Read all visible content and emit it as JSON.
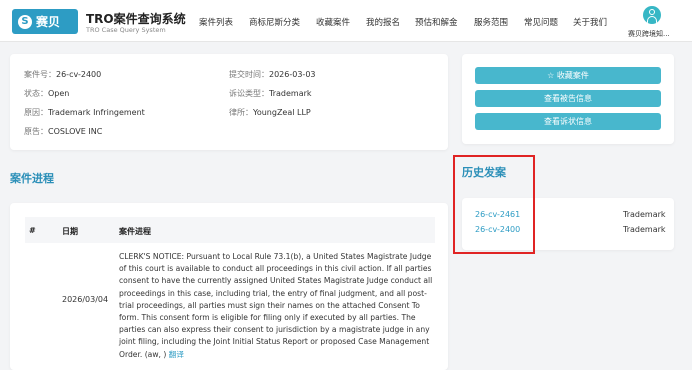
{
  "header": {
    "logo": "赛贝",
    "site_title": "TRO案件查询系统",
    "site_subtitle": "TRO Case Query System",
    "nav": [
      "案件列表",
      "商标尼斯分类",
      "收藏案件",
      "我的报名",
      "预估和解金",
      "服务范围",
      "常见问题",
      "关于我们"
    ],
    "user_name": "赛贝跨境知..."
  },
  "case_info": {
    "case_no_label": "案件号：",
    "case_no": "26-cv-2400",
    "filed_label": "提交时间：",
    "filed": "2026-03-03",
    "status_label": "状态：",
    "status": "Open",
    "type_label": "诉讼类型：",
    "type": "Trademark",
    "cause_label": "原因：",
    "cause": "Trademark Infringement",
    "firm_label": "律所：",
    "firm": "YoungZeal LLP",
    "plaintiff_label": "原告：",
    "plaintiff": "COSLOVE INC"
  },
  "actions": {
    "favorite": "☆ 收藏案件",
    "defendant": "查看被告信息",
    "complaint": "查看诉状信息"
  },
  "progress": {
    "title": "案件进程",
    "col_num": "#",
    "col_date": "日期",
    "col_progress": "案件进程",
    "row_date": "2026/03/04",
    "row_text": "CLERK'S NOTICE: Pursuant to Local Rule 73.1(b), a United States Magistrate Judge of this court is available to conduct all proceedings in this civil action. If all parties consent to have the currently assigned United States Magistrate Judge conduct all proceedings in this case, including trial, the entry of final judgment, and all post-trial proceedings, all parties must sign their names on the attached Consent To form. This consent form is eligible for filing only if executed by all parties. The parties can also express their consent to jurisdiction by a magistrate judge in any joint filing, including the Joint Initial Status Report or proposed Case Management Order. (aw, )",
    "translate": "翻译"
  },
  "history": {
    "title": "历史发案",
    "items": [
      {
        "case": "26-cv-2461",
        "type": "Trademark"
      },
      {
        "case": "26-cv-2400",
        "type": "Trademark"
      }
    ]
  }
}
